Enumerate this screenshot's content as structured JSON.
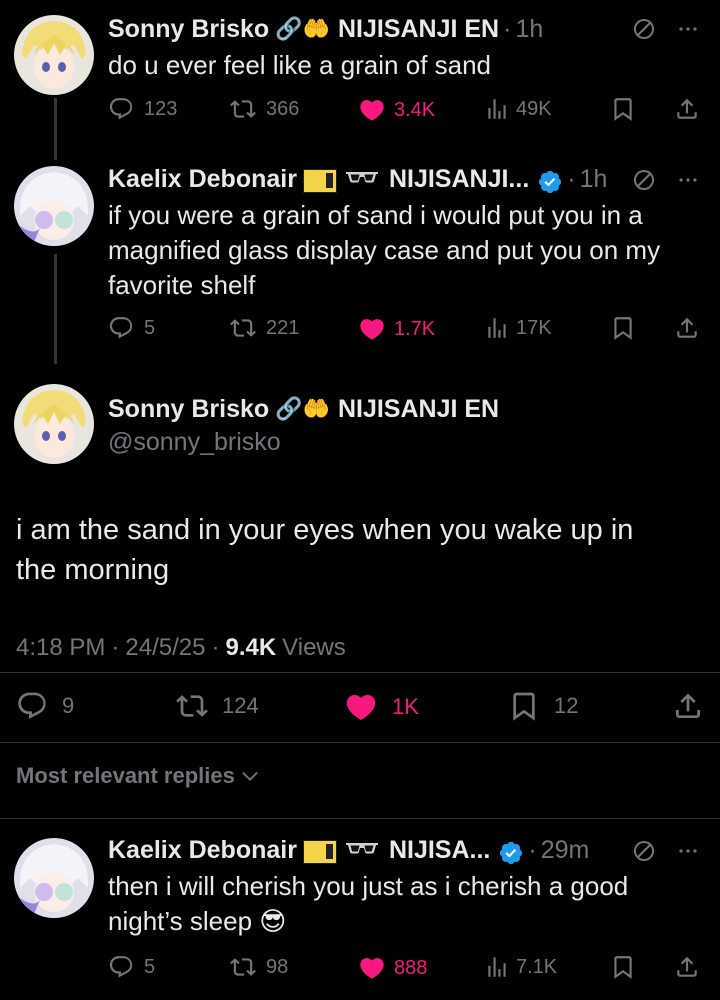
{
  "tweets": [
    {
      "name": "Sonny Brisko",
      "emojis": "🔗🤲",
      "affiliation": "NIJISANJI EN",
      "time": "1h",
      "text": "do u ever feel like a grain of sand",
      "replies": "123",
      "retweets": "366",
      "likes": "3.4K",
      "views": "49K"
    },
    {
      "name": "Kaelix Debonair",
      "affiliation": "NIJISANJI...",
      "time": "1h",
      "text_lines": [
        "if you were a grain of sand i would put you in a",
        "magnified glass display case and put you on my",
        "favorite shelf"
      ],
      "replies": "5",
      "retweets": "221",
      "likes": "1.7K",
      "views": "17K"
    }
  ],
  "focus": {
    "name": "Sonny Brisko",
    "emojis": "🔗🤲",
    "affiliation": "NIJISANJI EN",
    "handle": "@sonny_brisko",
    "text_lines": [
      "i am the sand in your eyes when you wake up in",
      "the morning"
    ],
    "time": "4:18 PM",
    "date": "24/5/25",
    "views_count": "9.4K",
    "views_label": "Views",
    "replies": "9",
    "retweets": "124",
    "likes": "1K",
    "bookmarks": "12"
  },
  "sort_label": "Most relevant replies",
  "reply": {
    "name": "Kaelix Debonair",
    "affiliation": "NIJISA...",
    "time": "29m",
    "text_lines": [
      "then i will cherish you just as i cherish a good",
      "night’s sleep 😎"
    ],
    "replies": "5",
    "retweets": "98",
    "likes": "888",
    "views": "7.1K"
  },
  "colors": {
    "background": "#000000",
    "text": "#e7e9ea",
    "secondary": "#71767b",
    "like": "#f91880",
    "verified": "#1d9bf0",
    "divider": "#2f3336"
  },
  "icons": [
    "reply-icon",
    "retweet-icon",
    "heart-icon",
    "views-icon",
    "bookmark-icon",
    "share-icon",
    "grok-icon",
    "more-icon",
    "verified-icon",
    "ticket-badge-icon",
    "sunglasses-badge-icon",
    "chevron-down-icon"
  ]
}
